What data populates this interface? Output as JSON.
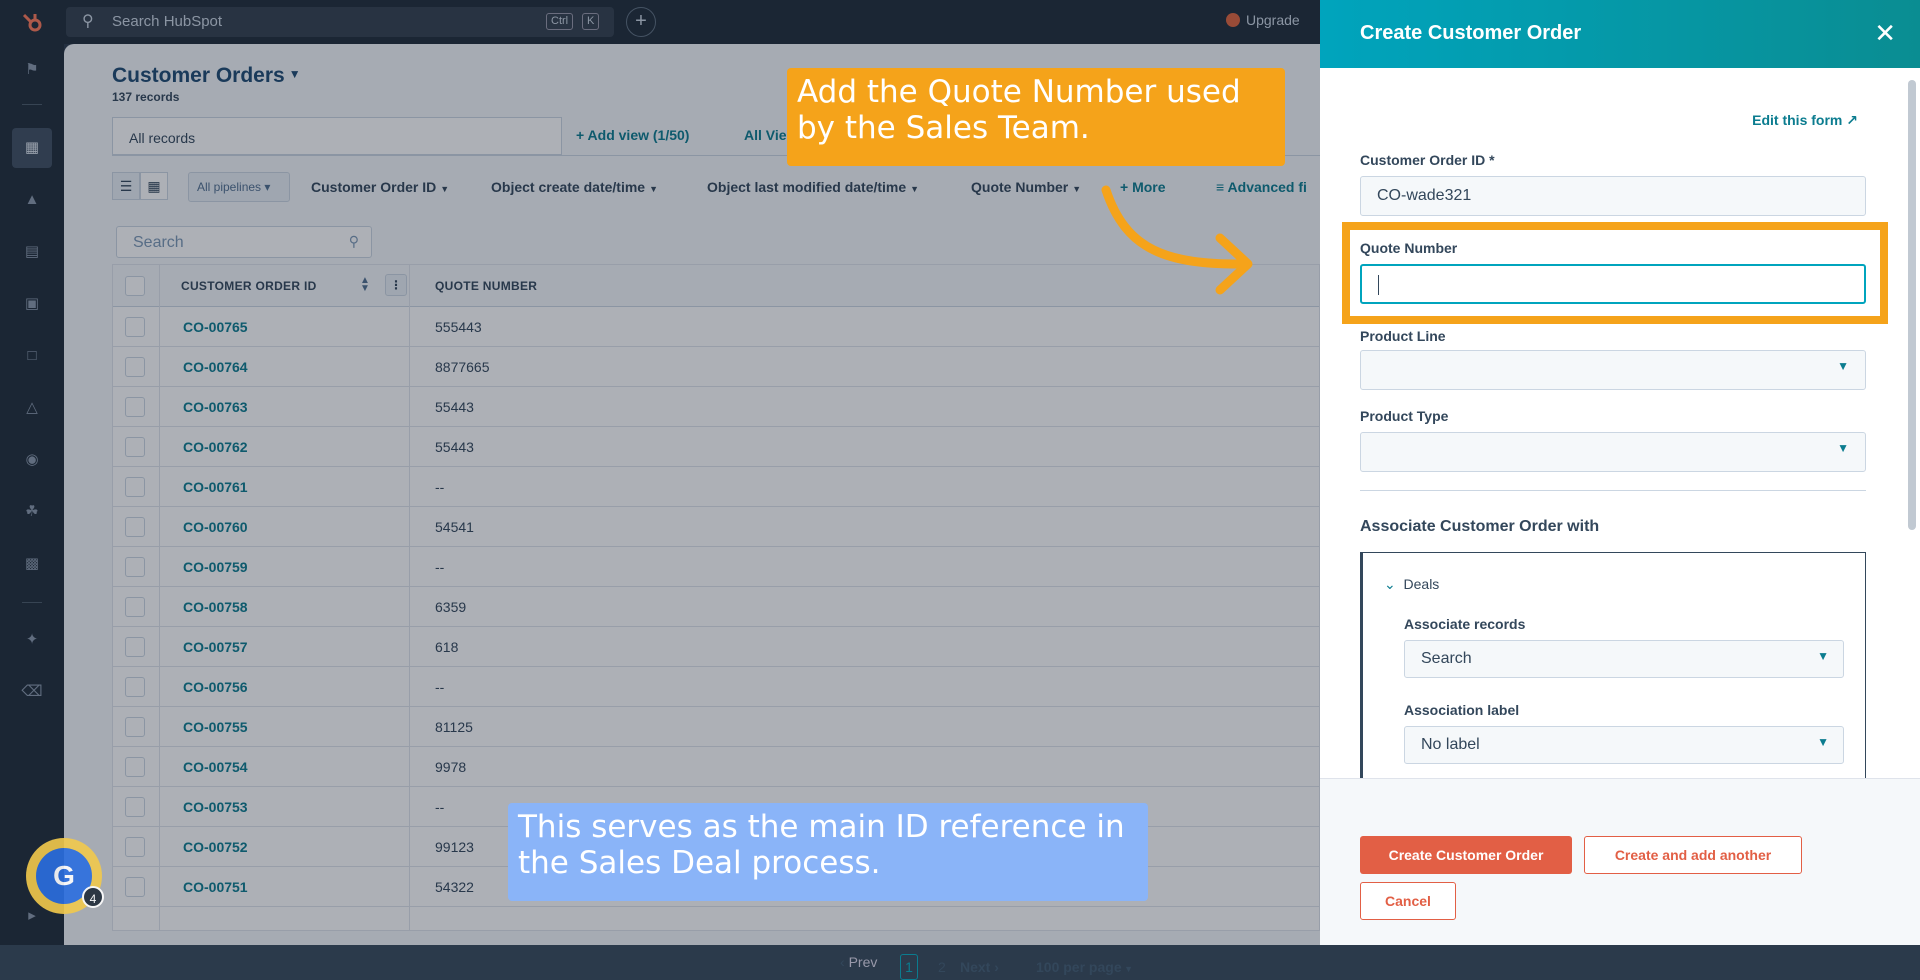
{
  "topbar": {
    "search_placeholder": "Search HubSpot",
    "shortcut_ctrl": "Ctrl",
    "shortcut_k": "K",
    "upgrade_label": "Upgrade"
  },
  "page": {
    "title": "Customer Orders",
    "record_count": "137 records",
    "view_tab": "All records",
    "add_view": "+ Add view (1/50)",
    "all_views": "All Vie"
  },
  "filters": {
    "pipelines": "All pipelines",
    "items": [
      "Customer Order ID",
      "Object create date/time",
      "Object last modified date/time",
      "Quote Number"
    ],
    "more": "+ More",
    "advanced": "Advanced fi"
  },
  "table": {
    "search_placeholder": "Search",
    "columns": [
      "CUSTOMER ORDER ID",
      "QUOTE NUMBER"
    ],
    "rows": [
      {
        "id": "CO-00765",
        "quote": "555443"
      },
      {
        "id": "CO-00764",
        "quote": "8877665"
      },
      {
        "id": "CO-00763",
        "quote": "55443"
      },
      {
        "id": "CO-00762",
        "quote": "55443"
      },
      {
        "id": "CO-00761",
        "quote": "--"
      },
      {
        "id": "CO-00760",
        "quote": "54541"
      },
      {
        "id": "CO-00759",
        "quote": "--"
      },
      {
        "id": "CO-00758",
        "quote": "6359"
      },
      {
        "id": "CO-00757",
        "quote": "618"
      },
      {
        "id": "CO-00756",
        "quote": "--"
      },
      {
        "id": "CO-00755",
        "quote": "81125"
      },
      {
        "id": "CO-00754",
        "quote": "9978"
      },
      {
        "id": "CO-00753",
        "quote": "--"
      },
      {
        "id": "CO-00752",
        "quote": "99123"
      },
      {
        "id": "CO-00751",
        "quote": "54322"
      }
    ]
  },
  "pagination": {
    "prev": "Prev",
    "page1": "1",
    "page2": "2",
    "next": "Next",
    "per_page": "100 per page"
  },
  "callouts": {
    "top": "Add the Quote Number used by the Sales Team.",
    "bottom": "This serves as the main ID reference in the Sales Deal process."
  },
  "badge": {
    "letter": "G",
    "count": "4"
  },
  "panel": {
    "title": "Create Customer Order",
    "edit_form": "Edit this form",
    "customer_order_id_label": "Customer Order ID *",
    "customer_order_id_value": "CO-wade321",
    "quote_number_label": "Quote Number",
    "quote_number_value": "",
    "product_line_label": "Product Line",
    "product_type_label": "Product Type",
    "associate_title": "Associate Customer Order with",
    "deals_label": "Deals",
    "associate_records_label": "Associate records",
    "associate_records_value": "Search",
    "association_label_label": "Association label",
    "association_label_value": "No label",
    "create_button": "Create Customer Order",
    "create_another_button": "Create and add another",
    "cancel_button": "Cancel"
  },
  "colors": {
    "accent_teal": "#0b7c8f",
    "callout_orange": "#f5a31a",
    "callout_blue": "#8ab4f8",
    "primary_button": "#e25f45"
  }
}
